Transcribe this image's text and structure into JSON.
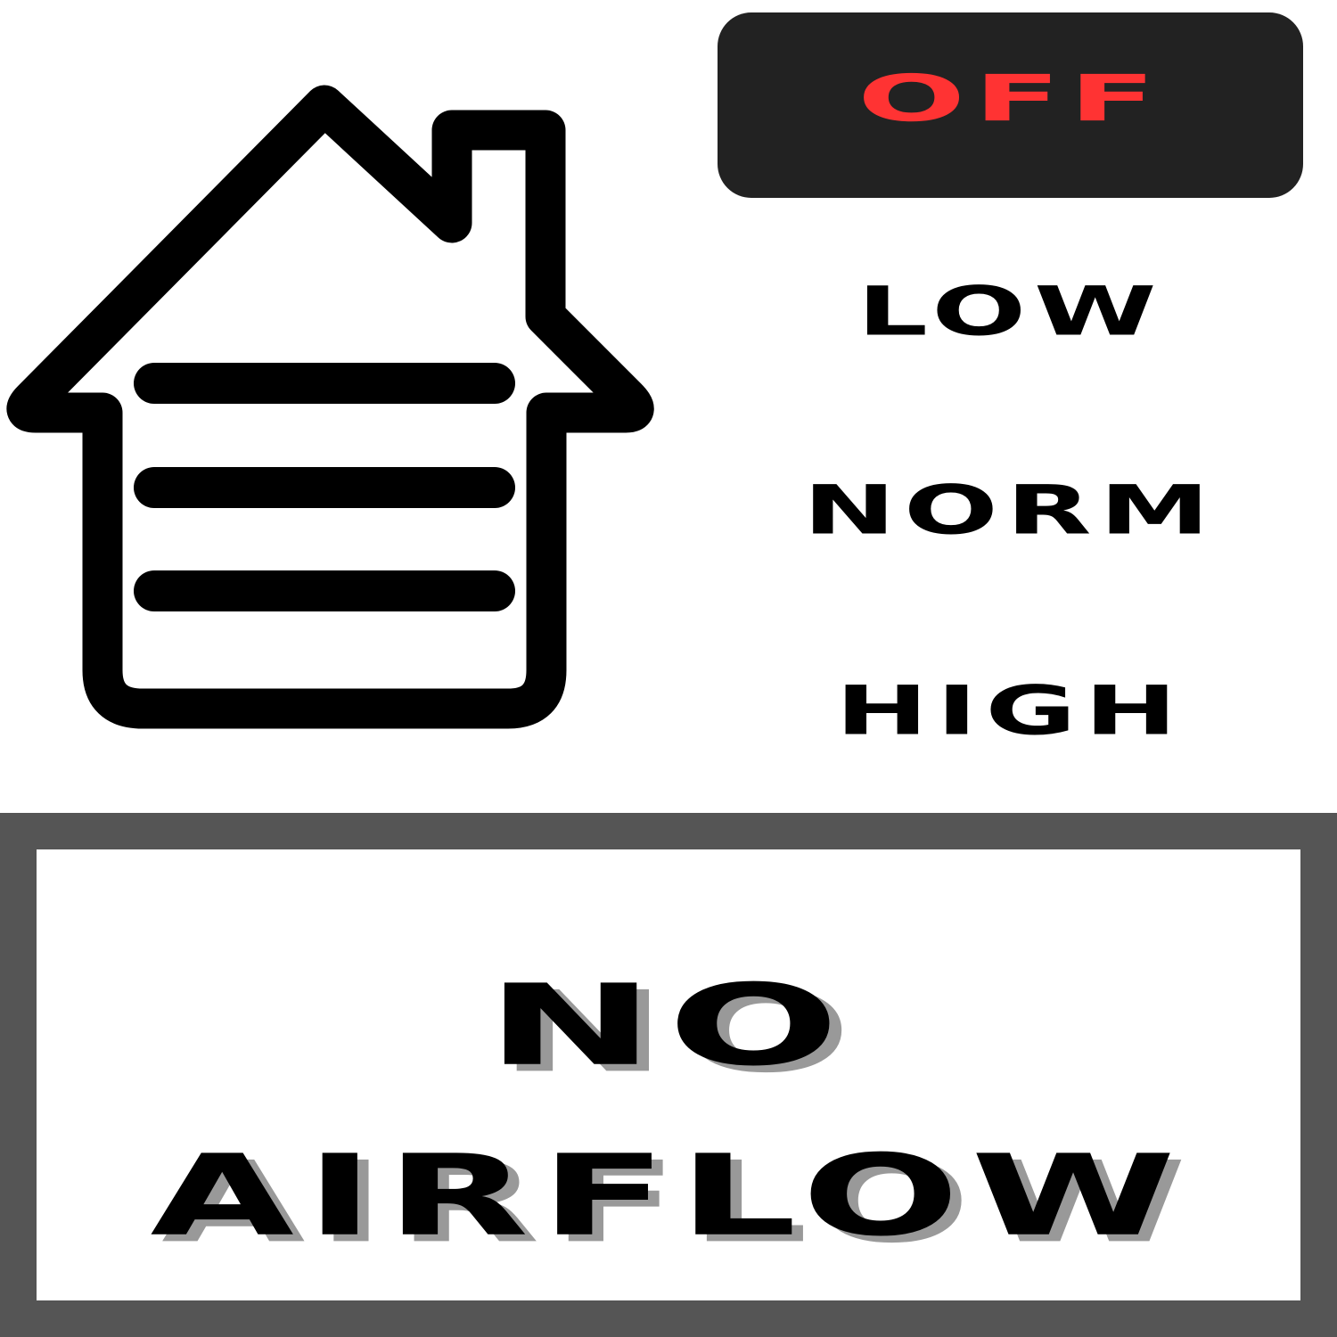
{
  "colors": {
    "background": "#ffffff",
    "active_mode_bg": "#222222",
    "active_mode_text": "#ff3333",
    "inactive_mode_text": "#000000",
    "status_frame": "#555555",
    "status_text": "#000000",
    "status_shadow": "#999999",
    "icon_stroke": "#000000"
  },
  "icon": {
    "name": "house-ventilation-icon"
  },
  "modes": {
    "active": "OFF",
    "options": [
      "LOW",
      "NORM",
      "HIGH"
    ]
  },
  "status": {
    "line1": "NO",
    "line2": "AIRFLOW"
  }
}
